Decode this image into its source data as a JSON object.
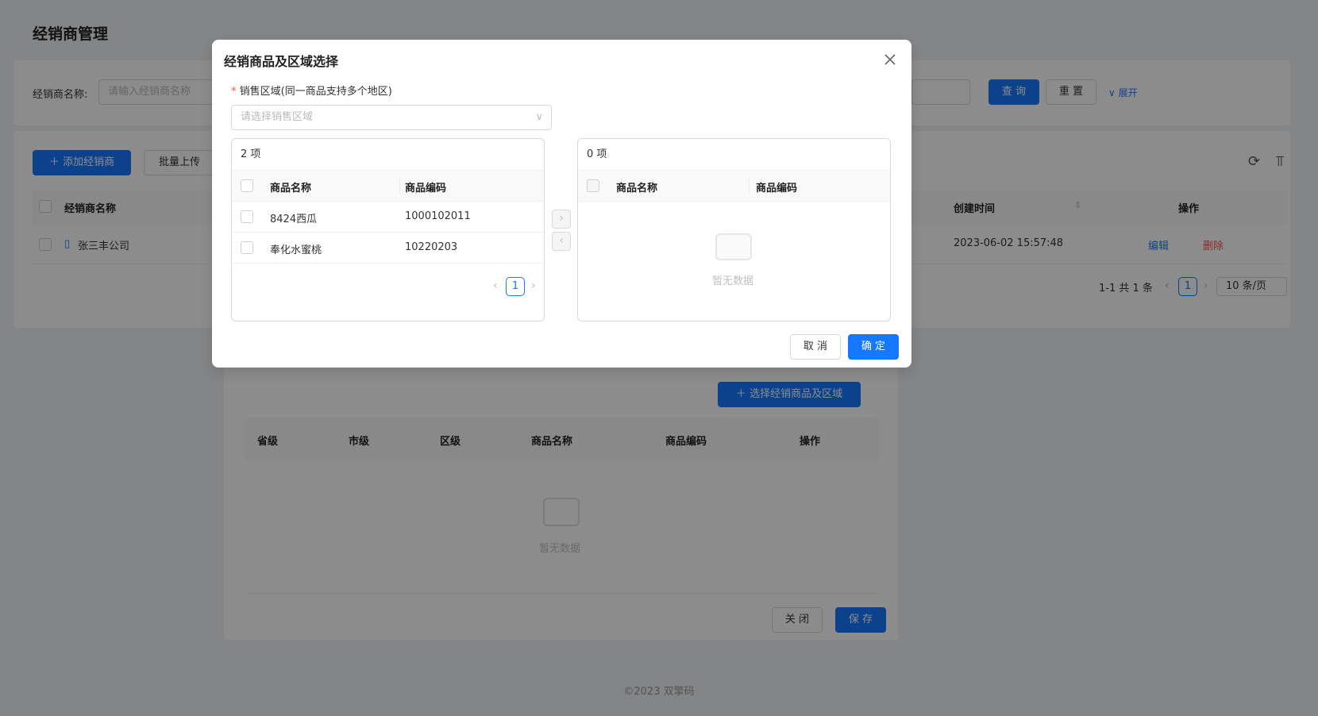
{
  "page": {
    "title": "经销商管理",
    "footer": "©2023 双擎码"
  },
  "search": {
    "name_label": "经销商名称:",
    "name_placeholder": "请输入经销商名称",
    "query_label": "查 询",
    "reset_label": "重 置",
    "expand_label": "展开"
  },
  "list": {
    "add_label": "添加经销商",
    "batch_upload_label": "批量上传",
    "columns": [
      "经销商名称",
      "创建时间",
      "操作"
    ],
    "rows": [
      {
        "name": "张三丰公司",
        "created": "2023-06-02 15:57:48",
        "edit": "编辑",
        "delete": "删除"
      }
    ],
    "pagination": {
      "summary": "1-1 共 1 条",
      "page": "1",
      "page_size": "10 条/页"
    }
  },
  "panel": {
    "select_label": "选择经销商品及区域",
    "columns": [
      "省级",
      "市级",
      "区级",
      "商品名称",
      "商品编码",
      "操作"
    ],
    "empty_text": "暂无数据",
    "close_label": "关 闭",
    "save_label": "保 存"
  },
  "modal": {
    "title": "经销商品及区域选择",
    "region_label": "销售区域(同一商品支持多个地区)",
    "region_placeholder": "请选择销售区域",
    "left": {
      "count": "2 项",
      "col_name": "商品名称",
      "col_code": "商品编码",
      "items": [
        {
          "name": "8424西瓜",
          "code": "1000102011"
        },
        {
          "name": "奉化水蜜桃",
          "code": "10220203"
        }
      ],
      "page": "1"
    },
    "right": {
      "count": "0 项",
      "col_name": "商品名称",
      "col_code": "商品编码",
      "empty_text": "暂无数据"
    },
    "cancel_label": "取 消",
    "ok_label": "确 定"
  },
  "colors": {
    "primary": "#1677ff",
    "danger": "#ff4d4f"
  }
}
